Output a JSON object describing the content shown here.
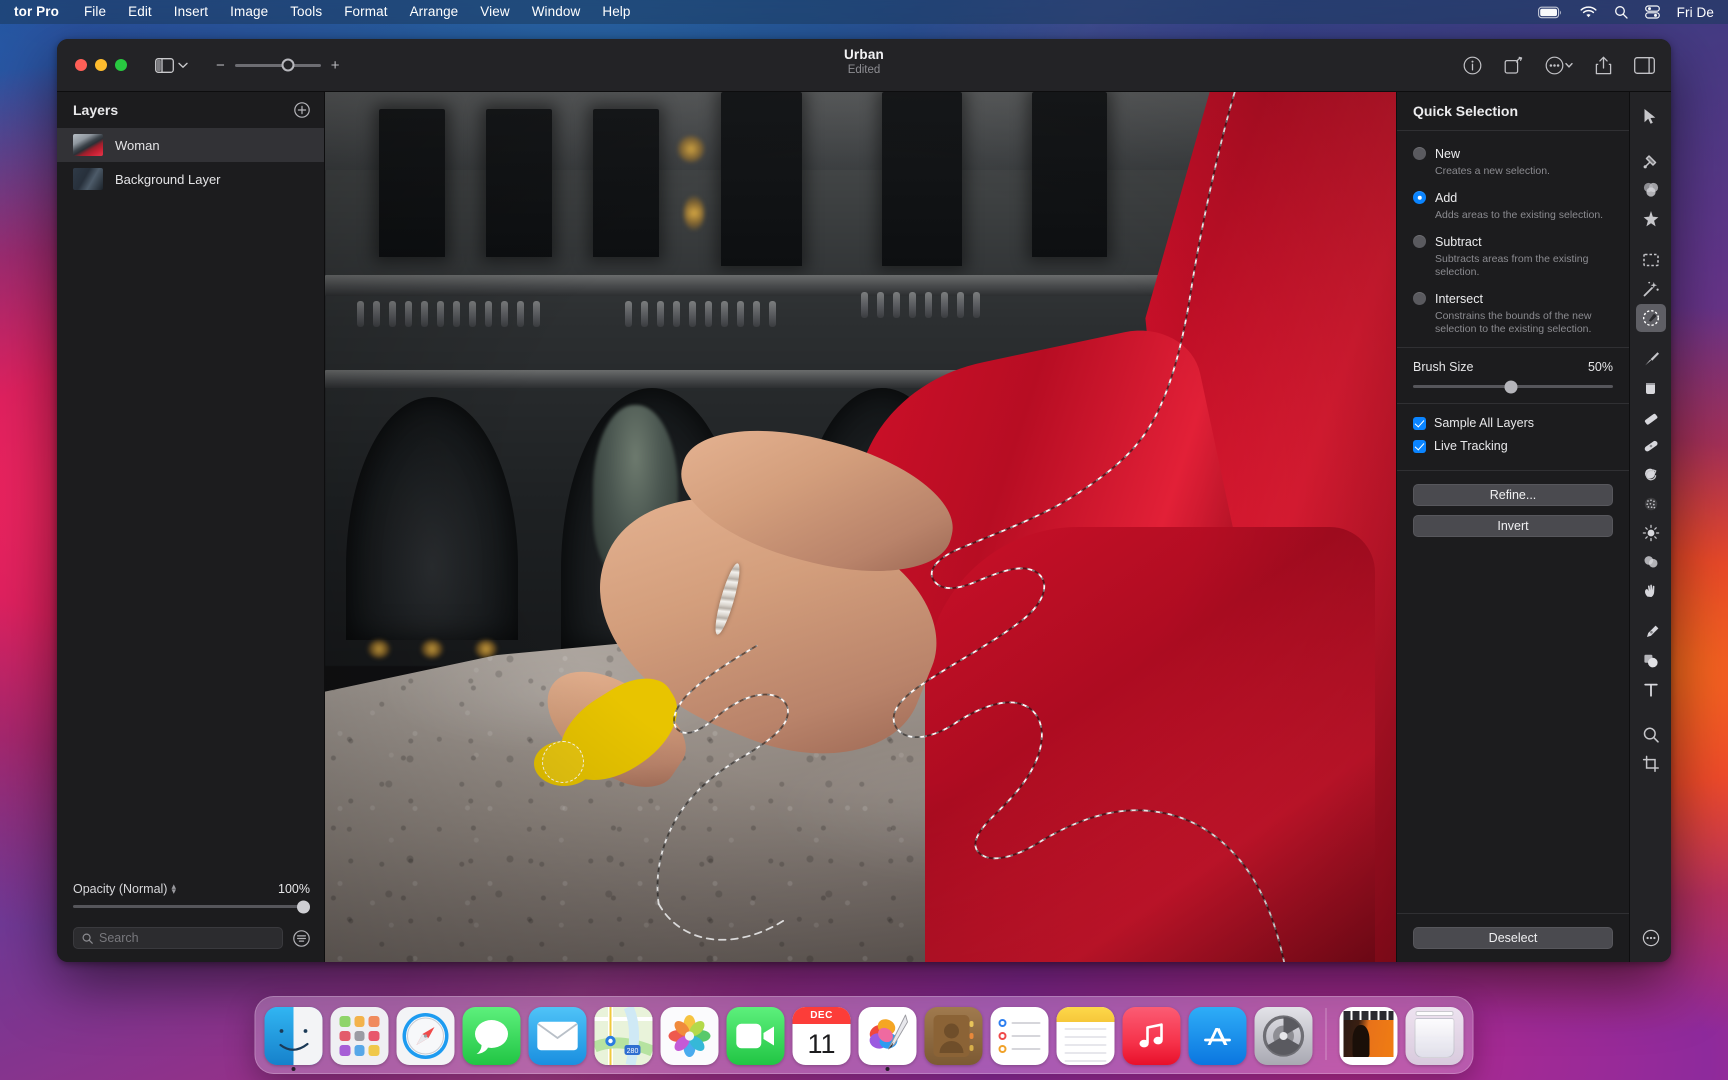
{
  "menubar": {
    "app": "tor Pro",
    "items": [
      "File",
      "Edit",
      "Insert",
      "Image",
      "Tools",
      "Format",
      "Arrange",
      "View",
      "Window",
      "Help"
    ],
    "status_icons": [
      "battery-icon",
      "wifi-icon",
      "search-icon",
      "control-center-icon"
    ],
    "clock": "Fri De"
  },
  "window": {
    "title": "Urban",
    "subtitle": "Edited",
    "zoom_minus": "−",
    "zoom_plus": "+",
    "toolbar_icons": [
      "info-icon",
      "rotate-icon",
      "more-options-icon",
      "share-icon",
      "inspector-toggle-icon"
    ]
  },
  "layers": {
    "title": "Layers",
    "add_label": "add-layer-icon",
    "items": [
      {
        "name": "Woman",
        "selected": true,
        "thumb": "thumb-woman"
      },
      {
        "name": "Background Layer",
        "selected": false,
        "thumb": "thumb-bg"
      }
    ],
    "opacity_label": "Opacity (Normal)",
    "opacity_value": "100%",
    "search_placeholder": "Search"
  },
  "inspector": {
    "title": "Quick Selection",
    "modes": [
      {
        "label": "New",
        "desc": "Creates a new selection.",
        "selected": false
      },
      {
        "label": "Add",
        "desc": "Adds areas to the existing selection.",
        "selected": true
      },
      {
        "label": "Subtract",
        "desc": "Subtracts areas from the existing selection.",
        "selected": false
      },
      {
        "label": "Intersect",
        "desc": "Constrains the bounds of the new selection to the existing selection.",
        "selected": false
      }
    ],
    "brush_size_label": "Brush Size",
    "brush_size_value": "50%",
    "checkboxes": [
      {
        "label": "Sample All Layers",
        "checked": true
      },
      {
        "label": "Live Tracking",
        "checked": true
      }
    ],
    "buttons": [
      "Refine...",
      "Invert"
    ],
    "footer_button": "Deselect"
  },
  "tools": [
    {
      "name": "arrange-tool",
      "icon": "cursor-arrow-icon",
      "active": false
    },
    {
      "name": "color-adjust-tool",
      "icon": "color-adjust-icon",
      "active": false
    },
    {
      "name": "color-balance-tool",
      "icon": "three-circles-icon",
      "active": false
    },
    {
      "name": "effects-tool",
      "icon": "sparkle-star-icon",
      "active": false
    },
    {
      "name": "rectangular-select",
      "icon": "marquee-select-icon",
      "active": false
    },
    {
      "name": "magic-wand-select",
      "icon": "magic-wand-icon",
      "active": false
    },
    {
      "name": "quick-selection",
      "icon": "quick-selection-icon",
      "active": true
    },
    {
      "name": "paint-tool",
      "icon": "paintbrush-icon",
      "active": false
    },
    {
      "name": "paint-bucket-tool",
      "icon": "paint-bucket-icon",
      "active": false
    },
    {
      "name": "eraser-tool",
      "icon": "eraser-icon",
      "active": false
    },
    {
      "name": "repair-tool",
      "icon": "bandage-heal-icon",
      "active": false
    },
    {
      "name": "clone-tool",
      "icon": "clone-stamp-icon",
      "active": false
    },
    {
      "name": "smudge-tool",
      "icon": "smudge-dots-icon",
      "active": false
    },
    {
      "name": "lighten-tool",
      "icon": "sun-dodge-icon",
      "active": false
    },
    {
      "name": "blur-tool",
      "icon": "blur-drops-icon",
      "active": false
    },
    {
      "name": "warp-tool",
      "icon": "warp-hand-icon",
      "active": false
    },
    {
      "name": "pen-tool",
      "icon": "pen-nib-icon",
      "active": false
    },
    {
      "name": "shape-tool",
      "icon": "shapes-icon",
      "active": false
    },
    {
      "name": "type-tool",
      "icon": "text-t-icon",
      "active": false
    },
    {
      "name": "zoom-tool",
      "icon": "magnifier-icon",
      "active": false
    },
    {
      "name": "crop-tool",
      "icon": "crop-icon",
      "active": false
    },
    {
      "name": "more-tools",
      "icon": "more-ellipsis-icon",
      "active": false
    }
  ],
  "canvas": {
    "description": "Photo of a woman in a red coat seated on a stone ledge with a selection outline and a yellow brush stroke on her foot",
    "brush_cursor": "brush-cursor",
    "selection_active": true
  },
  "dock": {
    "items": [
      {
        "name": "Finder",
        "icon": "finder-icon",
        "running": true
      },
      {
        "name": "Launchpad",
        "icon": "launchpad-icon",
        "running": false
      },
      {
        "name": "Safari",
        "icon": "safari-icon",
        "running": false
      },
      {
        "name": "Messages",
        "icon": "messages-icon",
        "running": false
      },
      {
        "name": "Mail",
        "icon": "mail-icon",
        "running": false
      },
      {
        "name": "Maps",
        "icon": "maps-icon",
        "running": false
      },
      {
        "name": "Photos",
        "icon": "photos-icon",
        "running": false
      },
      {
        "name": "FaceTime",
        "icon": "facetime-icon",
        "running": false
      },
      {
        "name": "Calendar",
        "icon": "calendar-icon",
        "running": false,
        "month": "DEC",
        "day": "11"
      },
      {
        "name": "Pixelmator Pro",
        "icon": "pixelmator-icon",
        "running": true
      },
      {
        "name": "Contacts",
        "icon": "contacts-icon",
        "running": false
      },
      {
        "name": "Reminders",
        "icon": "reminders-icon",
        "running": false
      },
      {
        "name": "Notes",
        "icon": "notes-icon",
        "running": false
      },
      {
        "name": "Music",
        "icon": "music-icon",
        "running": false
      },
      {
        "name": "App Store",
        "icon": "appstore-icon",
        "running": false
      },
      {
        "name": "System Settings",
        "icon": "settings-icon",
        "running": false
      }
    ],
    "after_separator": [
      {
        "name": "Urban image file",
        "icon": "image-file-icon"
      },
      {
        "name": "Trash",
        "icon": "trash-icon"
      }
    ]
  },
  "colors": {
    "accent": "#0a84ff",
    "panel_bg": "#1c1c1e",
    "titlebar_bg": "#232326",
    "selected_row": "#323236",
    "coat_red": "#d6112a",
    "brush_yellow": "#e8c400"
  }
}
